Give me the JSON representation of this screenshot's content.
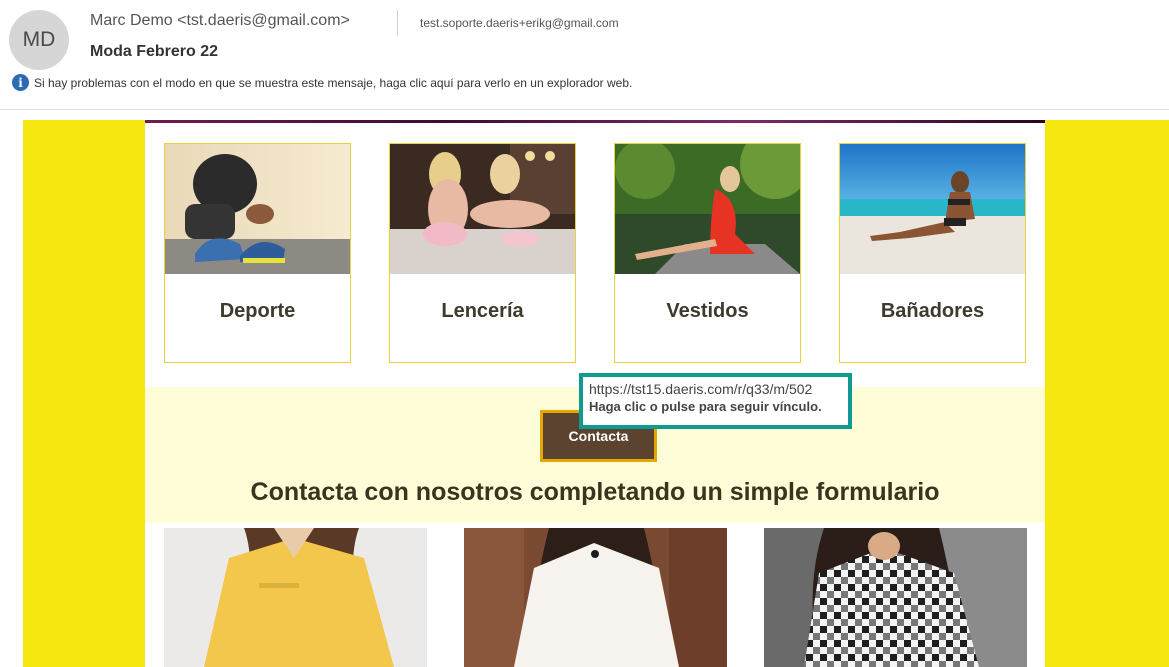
{
  "header": {
    "avatar_initials": "MD",
    "sender": "Marc Demo <tst.daeris@gmail.com>",
    "recipient": "test.soporte.daeris+erikg@gmail.com",
    "subject": "Moda Febrero 22",
    "info_message": "Si hay problemas con el modo en que se muestra este mensaje, haga clic aquí para verlo en un explorador web.",
    "info_icon": "info-icon"
  },
  "email": {
    "frame_color": "#f7e710",
    "categories": [
      {
        "label": "Deporte",
        "image": "running-shoes-photo"
      },
      {
        "label": "Lencería",
        "image": "lingerie-photo"
      },
      {
        "label": "Vestidos",
        "image": "red-dress-photo"
      },
      {
        "label": "Bañadores",
        "image": "swimsuit-beach-photo"
      }
    ],
    "contact_button": "Contacta",
    "headline": "Contacta con nosotros completando un simple formulario",
    "bottom_images": [
      "yellow-shirt-photo",
      "white-blouse-photo",
      "plaid-shirt-photo"
    ]
  },
  "tooltip": {
    "url": "https://tst15.daeris.com/r/q33/m/502",
    "hint": "Haga clic o pulse para seguir vínculo."
  }
}
